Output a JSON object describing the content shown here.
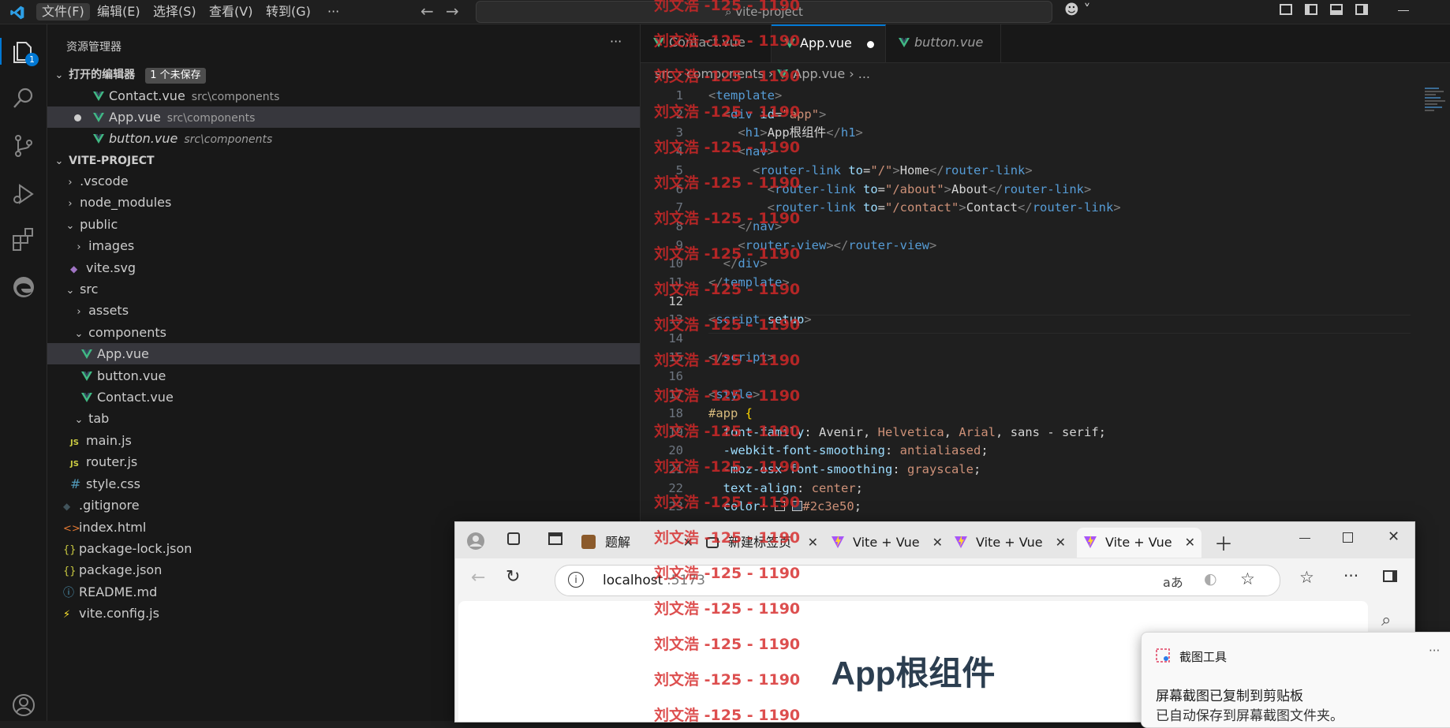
{
  "menu": [
    "文件(F)",
    "编辑(E)",
    "选择(S)",
    "查看(V)",
    "转到(G)",
    "···"
  ],
  "search": {
    "text": "vite-project"
  },
  "activity": {
    "explorer_badge": "1"
  },
  "sidebar": {
    "title": "资源管理器",
    "more": "···",
    "open_editors": {
      "label": "打开的编辑器",
      "badge": "1 个未保存",
      "items": [
        {
          "name": "Contact.vue",
          "path": "src\\components"
        },
        {
          "name": "App.vue",
          "path": "src\\components"
        },
        {
          "name": "button.vue",
          "path": "src\\components"
        }
      ]
    },
    "project": {
      "label": "VITE-PROJECT",
      "tree": [
        ".vscode",
        "node_modules",
        "public",
        "images",
        "vite.svg",
        "src",
        "assets",
        "components",
        "App.vue",
        "button.vue",
        "Contact.vue",
        "tab",
        "main.js",
        "router.js",
        "style.css",
        ".gitignore",
        "index.html",
        "package-lock.json",
        "package.json",
        "README.md",
        "vite.config.js"
      ]
    }
  },
  "editor": {
    "tabs": [
      "Contact.vue",
      "App.vue",
      "button.vue"
    ],
    "breadcrumb": [
      "src",
      "components",
      "App.vue",
      "..."
    ],
    "line_numbers": [
      "1",
      "2",
      "3",
      "4",
      "5",
      "6",
      "7",
      "8",
      "9",
      "10",
      "11",
      "12",
      "13",
      "14",
      "15",
      "16",
      "17",
      "18",
      "19",
      "20",
      "21",
      "22",
      "23"
    ],
    "code": {
      "l1": "template",
      "l2_tag": "div",
      "l2_attr": "id",
      "l2_val": "\"app\"",
      "l3_tag": "h1",
      "l3_text": "App根组件",
      "l4_tag": "nav",
      "l5_tag": "router-link",
      "l5_attr": "to",
      "l5_val": "\"/\"",
      "l5_text": "Home",
      "l6_val": "\"/about\"",
      "l6_text": "About",
      "l7_val": "\"/contact\"",
      "l7_text": "Contact",
      "l8_tag": "nav",
      "l9_tag": "router-view",
      "l10_tag": "div",
      "l11_tag": "template",
      "l13_tag": "script",
      "l13_attr": "setup",
      "l15_tag": "script",
      "l17_tag": "style",
      "l18_sel": "#app",
      "l18_brace": "{",
      "l19_prop": "font-family",
      "l19_v1": "Avenir",
      "l19_v2": "Helvetica",
      "l19_v3": "Arial",
      "l19_v4": "sans - serif",
      "l20_prop": "-webkit-font-smoothing",
      "l20_val": "antialiased",
      "l21_prop": "-moz-osx-font-smoothing",
      "l21_val": "grayscale",
      "l22_prop": "text-align",
      "l22_val": "center",
      "l23_prop": "color",
      "l23_val": "#2c3e50"
    }
  },
  "browser": {
    "tabs": [
      "题解",
      "新建标签页",
      "Vite + Vue",
      "Vite + Vue",
      "Vite + Vue"
    ],
    "url_host": "localhost",
    "url_port": ":5173",
    "page_heading": "App根组件"
  },
  "toast": {
    "app": "截图工具",
    "more": "···",
    "title": "屏幕截图已复制到剪贴板",
    "body": "已自动保存到屏幕截图文件夹。"
  },
  "watermark": "刘文浩 -125 - 1190",
  "colors": {
    "accent": "#0078d4",
    "vue_green": "#41b883",
    "page_heading": "#2c3e50"
  }
}
